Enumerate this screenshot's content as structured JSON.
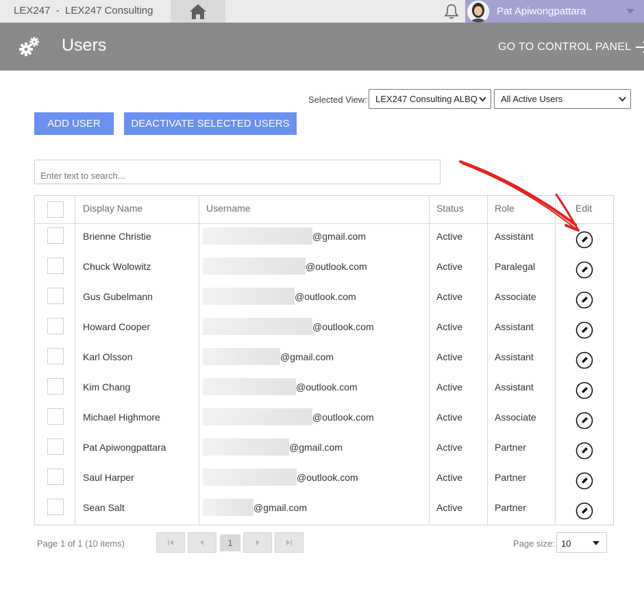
{
  "topbar": {
    "app_title": "LEX247  -  LEX247 Consulting",
    "home_icon": "home-icon",
    "bell_icon": "bell-icon",
    "user_name": "Pat Apiwongpattara",
    "menu_color": "#a4a2d3"
  },
  "header": {
    "icon": "gear-icon",
    "title": "Users",
    "control_panel_link": "GO TO CONTROL PANEL"
  },
  "view": {
    "label": "Selected View:",
    "office_value": "LEX247 Consulting ALBQ",
    "users_value": "All Active Users"
  },
  "actions": {
    "add_user": "ADD USER",
    "deactivate": "DEACTIVATE SELECTED USERS",
    "accent_color": "#6b8ff0"
  },
  "search": {
    "placeholder": "Enter text to search..."
  },
  "table": {
    "columns": [
      "Display Name",
      "Username",
      "Status",
      "Role",
      "Edit"
    ],
    "rows": [
      {
        "name": "Brienne Christie",
        "username": "@gmail.com",
        "status": "Active",
        "role": "Assistant"
      },
      {
        "name": "Chuck Wolowitz",
        "username": "@outlook.com",
        "status": "Active",
        "role": "Paralegal"
      },
      {
        "name": "Gus Gubelmann",
        "username": "@outlook.com",
        "status": "Active",
        "role": "Associate"
      },
      {
        "name": "Howard Cooper",
        "username": "@outlook.com",
        "status": "Active",
        "role": "Assistant"
      },
      {
        "name": "Karl Olsson",
        "username": "@gmail.com",
        "status": "Active",
        "role": "Assistant"
      },
      {
        "name": "Kim Chang",
        "username": "@outlook.com",
        "status": "Active",
        "role": "Assistant"
      },
      {
        "name": "Michael Highmore",
        "username": "@outlook.com",
        "status": "Active",
        "role": "Associate"
      },
      {
        "name": "Pat Apiwongpattara",
        "username": "@gmail.com",
        "status": "Active",
        "role": "Partner"
      },
      {
        "name": "Saul Harper",
        "username": "@outlook.com",
        "status": "Active",
        "role": "Partner"
      },
      {
        "name": "Sean Salt",
        "username": "@gmail.com",
        "status": "Active",
        "role": "Partner"
      }
    ]
  },
  "pager": {
    "info": "Page 1 of 1 (10 items)",
    "current_page": "1",
    "page_size_label": "Page size:",
    "page_size": "10"
  }
}
